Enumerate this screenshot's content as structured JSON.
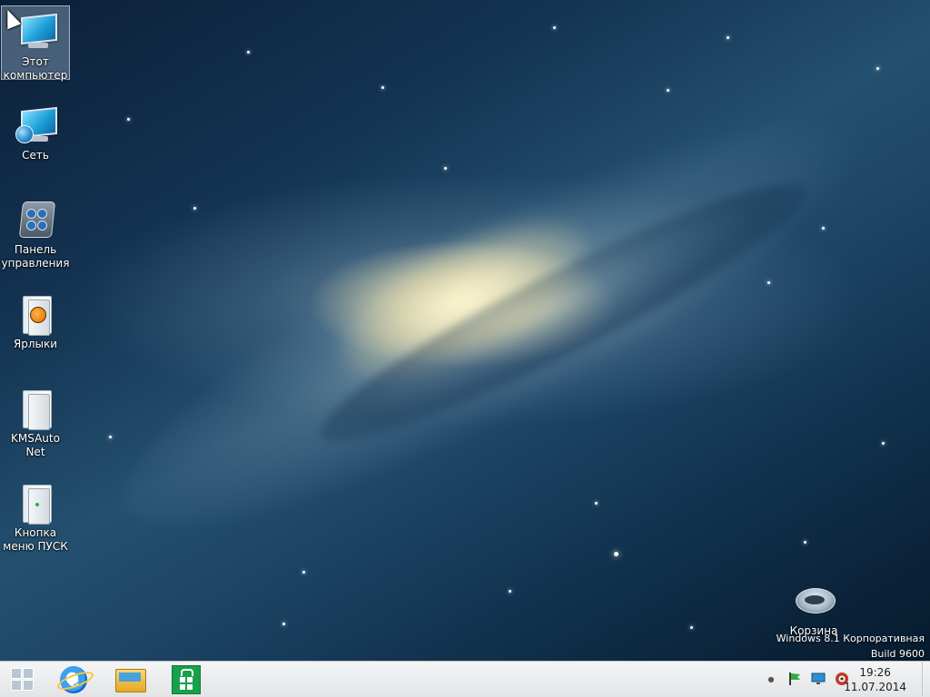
{
  "desktop": {
    "icons": [
      {
        "label": "Этот компьютер"
      },
      {
        "label": "Сеть"
      },
      {
        "label": "Панель управления"
      },
      {
        "label": "Ярлыки"
      },
      {
        "label": "KMSAuto Net"
      },
      {
        "label": "Кнопка меню ПУСК"
      },
      {
        "label": "Корзина"
      }
    ],
    "watermark": {
      "edition": "Windows 8.1 Корпоративная",
      "build": "Build 9600"
    }
  },
  "taskbar": {
    "pinned": [
      {
        "name": "start",
        "icon": "windows-logo-icon"
      },
      {
        "name": "internet-explorer",
        "icon": "internet-explorer-icon"
      },
      {
        "name": "file-explorer",
        "icon": "file-explorer-icon"
      },
      {
        "name": "store",
        "icon": "store-icon"
      }
    ],
    "tray": {
      "icons": [
        "show-hidden-icon",
        "action-center-flag-icon",
        "network-icon",
        "volume-icon"
      ]
    },
    "clock": {
      "time": "19:26",
      "date": "11.07.2014"
    }
  },
  "colors": {
    "taskbar_bg": "#e9ebed",
    "store_green": "#18a04a",
    "ie_blue": "#1e6fd0"
  }
}
